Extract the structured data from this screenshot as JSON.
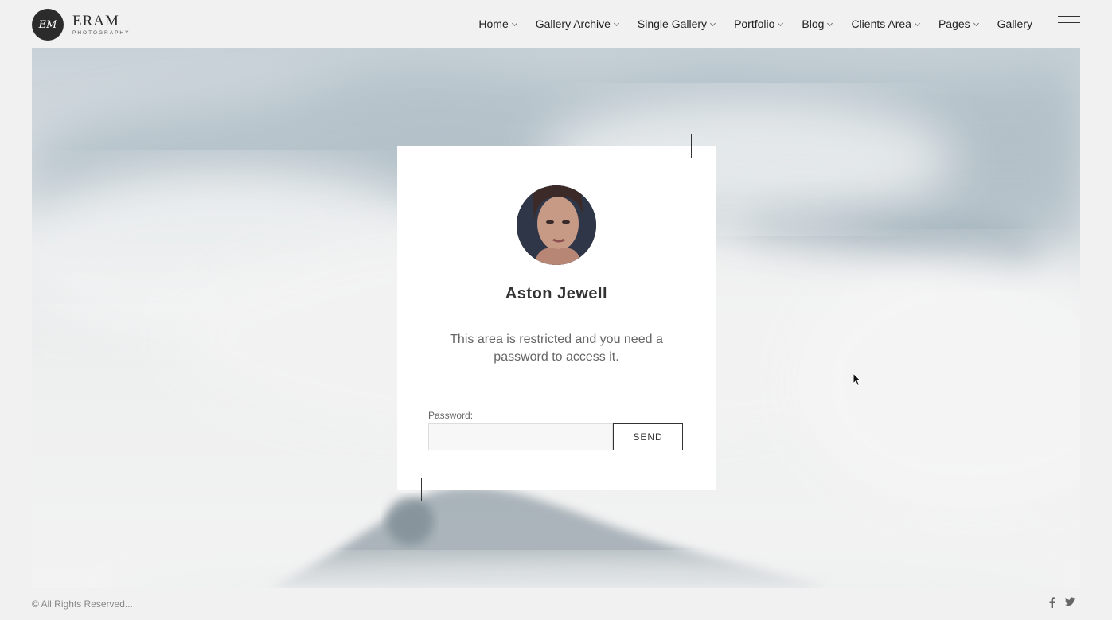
{
  "logo": {
    "monogram": "EM",
    "name": "ERAM",
    "tagline": "PHOTOGRAPHY"
  },
  "nav": {
    "items": [
      {
        "label": "Home",
        "has_dropdown": true
      },
      {
        "label": "Gallery Archive",
        "has_dropdown": true
      },
      {
        "label": "Single Gallery",
        "has_dropdown": true
      },
      {
        "label": "Portfolio",
        "has_dropdown": true
      },
      {
        "label": "Blog",
        "has_dropdown": true
      },
      {
        "label": "Clients Area",
        "has_dropdown": true
      },
      {
        "label": "Pages",
        "has_dropdown": true
      },
      {
        "label": "Gallery",
        "has_dropdown": false
      }
    ],
    "menu_icon": "hamburger-icon"
  },
  "card": {
    "name": "Aston Jewell",
    "message": "This area is restricted and you need a password to access it.",
    "password_label": "Password:",
    "password_value": "",
    "send_label": "SEND"
  },
  "footer": {
    "copyright": "© All Rights Reserved...",
    "social": [
      {
        "icon": "facebook-icon",
        "glyph": "f"
      },
      {
        "icon": "twitter-icon",
        "glyph": "t"
      }
    ]
  },
  "colors": {
    "page_bg": "#f1f1f1",
    "text": "#222222",
    "card_bg": "#ffffff",
    "muted": "#888888"
  }
}
